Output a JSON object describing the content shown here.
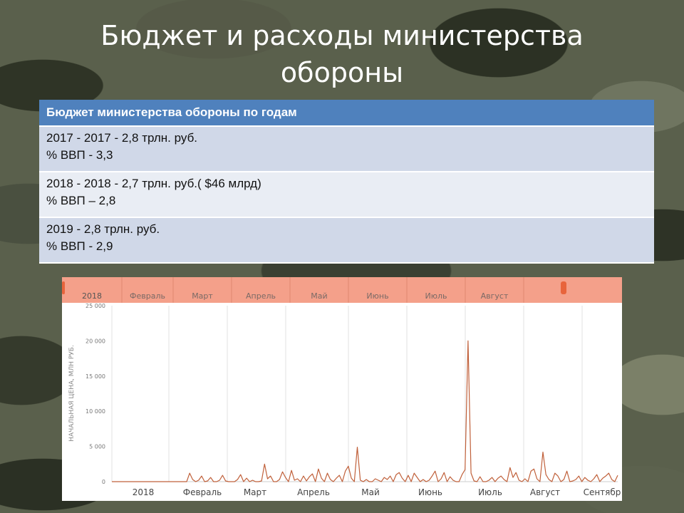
{
  "slide": {
    "title_line1": "Бюджет и расходы министерства",
    "title_line2": "обороны"
  },
  "table": {
    "header": "Бюджет министерства обороны по годам",
    "rows": [
      {
        "line1": "2017  - 2017 - 2,8 трлн. руб.",
        "line2": "% ВВП - 3,3"
      },
      {
        "line1": "2018  - 2018 - 2,7 трлн. руб.( $46 млрд)",
        "line2": "% ВВП – 2,8"
      },
      {
        "line1": "2019 - 2,8 трлн. руб.",
        "line2": "% ВВП - 2,9"
      }
    ]
  },
  "colors": {
    "header_blue": "#4f81bd",
    "navigator_bar": "#f4a08a",
    "navigator_handle": "#e8643c",
    "series_line": "#c0603a"
  },
  "chart_data": {
    "type": "line",
    "ylabel": "НАЧАЛЬНАЯ ЦЕНА, МЛН РУБ.",
    "ylim": [
      0,
      25000
    ],
    "yticks": [
      "25 000",
      "20 000",
      "15 000",
      "10 000",
      "5 000",
      "0"
    ],
    "xticks": [
      "2018",
      "Февраль",
      "Март",
      "Апрель",
      "Май",
      "Июнь",
      "Июль",
      "Август",
      "Сентябр"
    ],
    "navigator_labels": [
      "2018",
      "Февраль",
      "Март",
      "Апрель",
      "Май",
      "Июнь",
      "Июль",
      "Август"
    ],
    "grid": true,
    "series": [
      {
        "values": [
          0,
          0,
          0,
          0,
          0,
          0,
          0,
          0,
          0,
          0,
          0,
          0,
          0,
          0,
          0,
          0,
          0,
          0,
          0,
          0,
          0,
          0,
          0,
          0,
          0,
          0,
          1200,
          300,
          0,
          200,
          800,
          0,
          100,
          600,
          0,
          0,
          200,
          900,
          100,
          0,
          0,
          0,
          300,
          1000,
          0,
          500,
          0,
          200,
          0,
          0,
          100,
          2500,
          400,
          800,
          0,
          0,
          300,
          1400,
          600,
          0,
          1600,
          200,
          400,
          0,
          800,
          100,
          700,
          1100,
          0,
          1800,
          500,
          0,
          1200,
          300,
          0,
          500,
          900,
          0,
          1500,
          2200,
          500,
          0,
          4900,
          200,
          0,
          300,
          0,
          0,
          400,
          200,
          0,
          600,
          300,
          800,
          0,
          1000,
          1300,
          500,
          0,
          900,
          0,
          1200,
          600,
          0,
          300,
          0,
          200,
          800,
          1500,
          0,
          400,
          1300,
          0,
          700,
          200,
          0,
          0,
          1000,
          1700,
          20000,
          1200,
          100,
          0,
          700,
          0,
          0,
          200,
          600,
          0,
          500,
          800,
          300,
          0,
          2000,
          600,
          1300,
          200,
          0,
          400,
          0,
          1500,
          1800,
          400,
          0,
          4200,
          1000,
          300,
          0,
          1200,
          800,
          0,
          300,
          1500,
          0,
          100,
          300,
          800,
          0,
          600,
          200,
          0,
          400,
          1000,
          0,
          500,
          800,
          1200,
          300,
          0,
          900
        ]
      }
    ]
  }
}
